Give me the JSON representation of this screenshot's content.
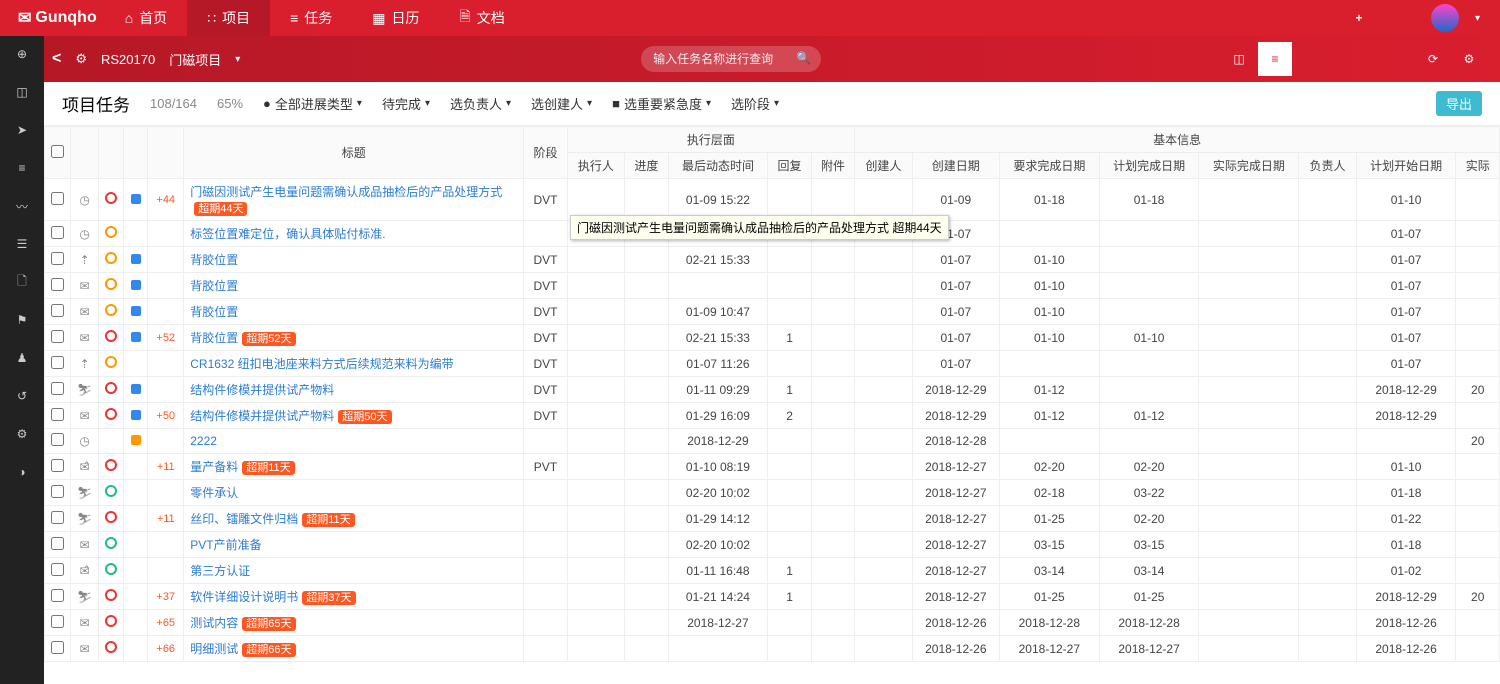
{
  "brand": "Gunqho",
  "topnav": [
    {
      "icon": "⌂",
      "label": "首页"
    },
    {
      "icon": "∷",
      "label": "项目"
    },
    {
      "icon": "≡",
      "label": "任务"
    },
    {
      "icon": "▦",
      "label": "日历"
    },
    {
      "icon": "🗎",
      "label": "文档"
    }
  ],
  "subbar": {
    "back": "<",
    "gear": "⚙",
    "code": "RS20170",
    "name": "门磁项目",
    "search_placeholder": "输入任务名称进行查询",
    "plus": "+"
  },
  "filter": {
    "title": "项目任务",
    "count": "108/164",
    "pct": "65%",
    "f1": "全部进展类型",
    "f2": "待完成",
    "f3": "选负责人",
    "f4": "选创建人",
    "f5": "选重要紧急度",
    "f6": "选阶段",
    "export": "导出"
  },
  "headers": {
    "title": "标题",
    "stage": "阶段",
    "exec_group": "执行层面",
    "executor": "执行人",
    "progress": "进度",
    "last_time": "最后动态时间",
    "reply": "回复",
    "attach": "附件",
    "info_group": "基本信息",
    "creator": "创建人",
    "cdate": "创建日期",
    "due": "要求完成日期",
    "plan": "计划完成日期",
    "actual": "实际完成日期",
    "owner": "负责人",
    "pstart": "计划开始日期",
    "areal": "实际"
  },
  "tooltip": "门磁因测试产生电量问题需确认成品抽检后的产品处理方式 超期44天",
  "rows": [
    {
      "ic": "◷",
      "dot": "red",
      "sq": "blue",
      "cnt": "+44",
      "title": "门磁因测试产生电量问题需确认成品抽检后的产品处理方式",
      "badge": "超期44天",
      "stage": "DVT",
      "last": "01-09 15:22",
      "cdate": "01-09",
      "due": "01-18",
      "plan": "01-18",
      "pstart": "01-10"
    },
    {
      "ic": "◷",
      "dot": "orange",
      "sq": "",
      "cnt": "",
      "title": "标签位置难定位，确认具体贴付标准.",
      "badge": "",
      "stage": "",
      "last": "",
      "cdate": "01-07",
      "due": "",
      "plan": "",
      "pstart": "01-07"
    },
    {
      "ic": "⇡",
      "dot": "orange",
      "sq": "blue",
      "cnt": "",
      "title": "背胶位置",
      "badge": "",
      "stage": "DVT",
      "last": "02-21 15:33",
      "cdate": "01-07",
      "due": "01-10",
      "plan": "",
      "pstart": "01-07"
    },
    {
      "ic": "✉",
      "dot": "orange",
      "sq": "blue",
      "cnt": "",
      "title": "背胶位置",
      "badge": "",
      "stage": "DVT",
      "last": "",
      "cdate": "01-07",
      "due": "01-10",
      "plan": "",
      "pstart": "01-07"
    },
    {
      "ic": "✉",
      "dot": "orange",
      "sq": "blue",
      "cnt": "",
      "title": "背胶位置",
      "badge": "",
      "stage": "DVT",
      "last": "01-09 10:47",
      "cdate": "01-07",
      "due": "01-10",
      "plan": "",
      "pstart": "01-07"
    },
    {
      "ic": "✉",
      "dot": "red",
      "sq": "blue",
      "cnt": "+52",
      "title": "背胶位置",
      "badge": "超期52天",
      "stage": "DVT",
      "last": "02-21 15:33",
      "reply": "1",
      "cdate": "01-07",
      "due": "01-10",
      "plan": "01-10",
      "pstart": "01-07"
    },
    {
      "ic": "⇡",
      "dot": "orange",
      "sq": "",
      "cnt": "",
      "title": "CR1632 纽扣电池座来料方式后续规范来料为编带",
      "badge": "",
      "stage": "DVT",
      "last": "01-07 11:26",
      "cdate": "01-07",
      "due": "",
      "plan": "",
      "pstart": "01-07"
    },
    {
      "ic": "⛷",
      "dot": "red",
      "sq": "blue",
      "cnt": "",
      "title": "结构件修模并提供试产物料",
      "badge": "",
      "stage": "DVT",
      "last": "01-11 09:29",
      "reply": "1",
      "cdate": "2018-12-29",
      "due": "01-12",
      "plan": "",
      "pstart": "2018-12-29",
      "areal": "20"
    },
    {
      "ic": "✉",
      "dot": "red",
      "sq": "blue",
      "cnt": "+50",
      "title": "结构件修模并提供试产物料",
      "badge": "超期50天",
      "stage": "DVT",
      "last": "01-29 16:09",
      "reply": "2",
      "cdate": "2018-12-29",
      "due": "01-12",
      "plan": "01-12",
      "pstart": "2018-12-29"
    },
    {
      "ic": "◷",
      "dot": "",
      "sq": "orange",
      "cnt": "",
      "title": "2222",
      "badge": "",
      "stage": "",
      "last": "2018-12-29",
      "cdate": "2018-12-28",
      "due": "",
      "plan": "",
      "pstart": "",
      "areal": "20"
    },
    {
      "ic": "✉̂",
      "dot": "red",
      "sq": "",
      "cnt": "+11",
      "title": "量产备料",
      "badge": "超期11天",
      "stage": "PVT",
      "last": "01-10 08:19",
      "cdate": "2018-12-27",
      "due": "02-20",
      "plan": "02-20",
      "pstart": "01-10"
    },
    {
      "ic": "⛷",
      "dot": "green",
      "sq": "",
      "cnt": "",
      "title": "零件承认",
      "badge": "",
      "stage": "",
      "last": "02-20 10:02",
      "cdate": "2018-12-27",
      "due": "02-18",
      "plan": "03-22",
      "pstart": "01-18"
    },
    {
      "ic": "⛷",
      "dot": "red",
      "sq": "",
      "cnt": "+11",
      "title": "丝印、镭雕文件归档",
      "badge": "超期11天",
      "stage": "",
      "last": "01-29 14:12",
      "cdate": "2018-12-27",
      "due": "01-25",
      "plan": "02-20",
      "pstart": "01-22"
    },
    {
      "ic": "✉",
      "dot": "green",
      "sq": "",
      "cnt": "",
      "title": "PVT产前准备",
      "badge": "",
      "stage": "",
      "last": "02-20 10:02",
      "cdate": "2018-12-27",
      "due": "03-15",
      "plan": "03-15",
      "pstart": "01-18"
    },
    {
      "ic": "✉̂",
      "dot": "green",
      "sq": "",
      "cnt": "",
      "title": "第三方认证",
      "badge": "",
      "stage": "",
      "last": "01-11 16:48",
      "reply": "1",
      "cdate": "2018-12-27",
      "due": "03-14",
      "plan": "03-14",
      "pstart": "01-02"
    },
    {
      "ic": "⛷",
      "dot": "red",
      "sq": "",
      "cnt": "+37",
      "title": "软件详细设计说明书",
      "badge": "超期37天",
      "stage": "",
      "last": "01-21 14:24",
      "reply": "1",
      "cdate": "2018-12-27",
      "due": "01-25",
      "plan": "01-25",
      "pstart": "2018-12-29",
      "areal": "20"
    },
    {
      "ic": "✉",
      "dot": "red",
      "sq": "",
      "cnt": "+65",
      "title": "测试内容",
      "badge": "超期65天",
      "stage": "",
      "last": "2018-12-27",
      "cdate": "2018-12-26",
      "due": "2018-12-28",
      "plan": "2018-12-28",
      "pstart": "2018-12-26"
    },
    {
      "ic": "✉",
      "dot": "red",
      "sq": "",
      "cnt": "+66",
      "title": "明细测试",
      "badge": "超期66天",
      "stage": "",
      "last": "",
      "cdate": "2018-12-26",
      "due": "2018-12-27",
      "plan": "2018-12-27",
      "pstart": "2018-12-26"
    }
  ]
}
